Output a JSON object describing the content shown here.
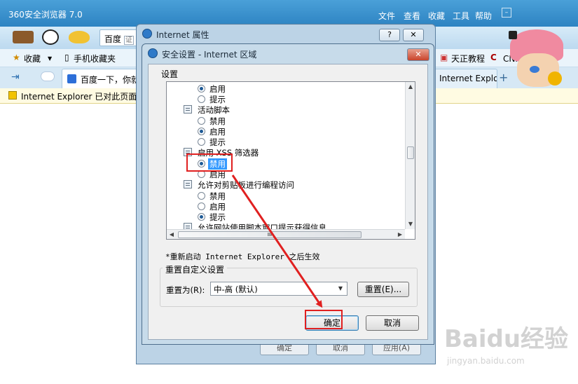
{
  "browser": {
    "title": "360安全浏览器 7.0",
    "menu": [
      "文件",
      "查看",
      "收藏",
      "工具",
      "帮助"
    ],
    "address_partial": "百度",
    "address_tag": "证",
    "favorites_bar": [
      "收藏",
      "手机收藏夹",
      "天正教程",
      "CNKI翻"
    ],
    "tabs": [
      "百度一下，你就",
      "Internet Explorer E"
    ],
    "infobar_text": "Internet Explorer 已对此页面进",
    "colors": {
      "chrome": "#2d83c2",
      "accent": "#e02020"
    }
  },
  "internet_properties": {
    "title": "Internet 属性",
    "help_btn": "?",
    "close_btn": "✕",
    "behind_buttons": [
      "确定",
      "取消",
      "应用(A)"
    ]
  },
  "security_dialog": {
    "title": "安全设置 - Internet 区域",
    "close_btn": "✕",
    "settings_label": "设置",
    "rows": [
      {
        "type": "radio",
        "label": "启用",
        "selected": true
      },
      {
        "type": "radio",
        "label": "提示",
        "selected": false
      },
      {
        "type": "header",
        "label": "活动脚本"
      },
      {
        "type": "radio",
        "label": "禁用",
        "selected": false
      },
      {
        "type": "radio",
        "label": "启用",
        "selected": true
      },
      {
        "type": "radio",
        "label": "提示",
        "selected": false
      },
      {
        "type": "header",
        "label": "启用 XSS 筛选器"
      },
      {
        "type": "radio",
        "label": "禁用",
        "selected": true,
        "highlighted": true
      },
      {
        "type": "radio",
        "label": "启用",
        "selected": false
      },
      {
        "type": "header",
        "label": "允许对剪贴板进行编程访问"
      },
      {
        "type": "radio",
        "label": "禁用",
        "selected": false
      },
      {
        "type": "radio",
        "label": "启用",
        "selected": false
      },
      {
        "type": "radio",
        "label": "提示",
        "selected": true
      },
      {
        "type": "header",
        "label": "允许网站使用脚本窗口提示获得信息"
      }
    ],
    "hscroll_grip": "III",
    "note": "*重新启动 Internet Explorer 之后生效",
    "reset_group_title": "重置自定义设置",
    "reset_label": "重置为(R):",
    "reset_value": "中-高 (默认)",
    "reset_button": "重置(E)...",
    "ok_button": "确定",
    "cancel_button": "取消"
  },
  "watermark": {
    "logo": "Baidu经验",
    "url": "jingyan.baidu.com"
  }
}
